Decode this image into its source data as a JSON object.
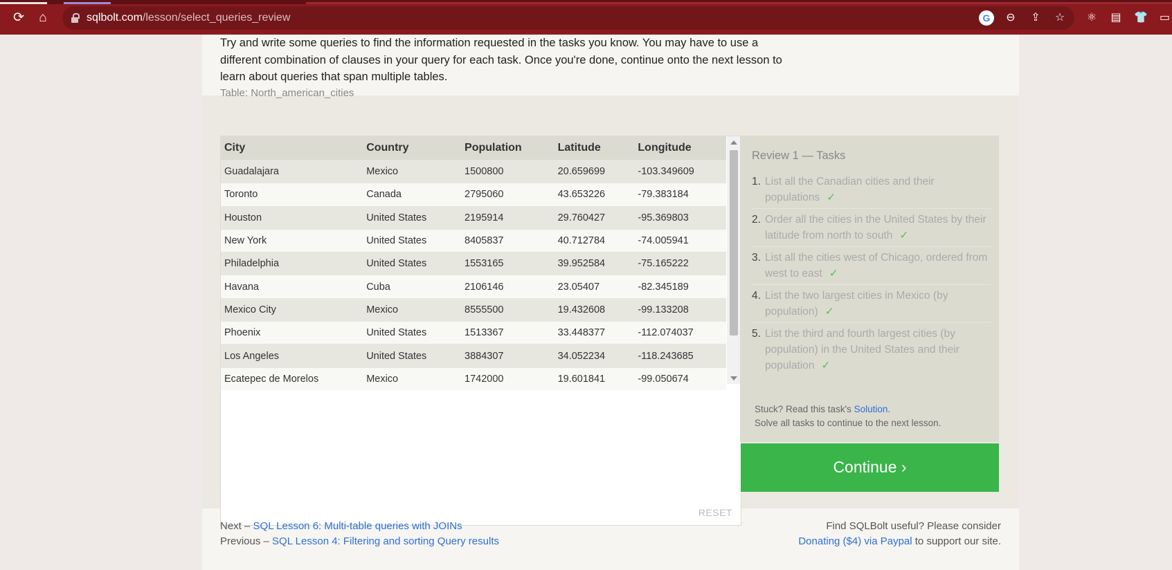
{
  "browser": {
    "url_domain": "sqlbolt.com",
    "url_path": "/lesson/select_queries_review"
  },
  "intro_text": "Try and write some queries to find the information requested in the tasks you know. You may have to use a different combination of clauses in your query for each task. Once you're done, continue onto the next lesson to learn about queries that span multiple tables.",
  "table": {
    "caption": "Table: North_american_cities",
    "columns": [
      "City",
      "Country",
      "Population",
      "Latitude",
      "Longitude"
    ],
    "rows": [
      [
        "Guadalajara",
        "Mexico",
        "1500800",
        "20.659699",
        "-103.349609"
      ],
      [
        "Toronto",
        "Canada",
        "2795060",
        "43.653226",
        "-79.383184"
      ],
      [
        "Houston",
        "United States",
        "2195914",
        "29.760427",
        "-95.369803"
      ],
      [
        "New York",
        "United States",
        "8405837",
        "40.712784",
        "-74.005941"
      ],
      [
        "Philadelphia",
        "United States",
        "1553165",
        "39.952584",
        "-75.165222"
      ],
      [
        "Havana",
        "Cuba",
        "2106146",
        "23.05407",
        "-82.345189"
      ],
      [
        "Mexico City",
        "Mexico",
        "8555500",
        "19.432608",
        "-99.133208"
      ],
      [
        "Phoenix",
        "United States",
        "1513367",
        "33.448377",
        "-112.074037"
      ],
      [
        "Los Angeles",
        "United States",
        "3884307",
        "34.052234",
        "-118.243685"
      ],
      [
        "Ecatepec de Morelos",
        "Mexico",
        "1742000",
        "19.601841",
        "-99.050674"
      ]
    ],
    "reset_label": "RESET"
  },
  "tasks": {
    "title": "Review 1 — Tasks",
    "check": "✓",
    "items": [
      {
        "num": "1.",
        "text": "List all the Canadian cities and their populations"
      },
      {
        "num": "2.",
        "text": "Order all the cities in the United States by their latitude from north to south"
      },
      {
        "num": "3.",
        "text": "List all the cities west of Chicago, ordered from west to east"
      },
      {
        "num": "4.",
        "text": "List the two largest cities in Mexico (by population)"
      },
      {
        "num": "5.",
        "text": "List the third and fourth largest cities (by population) in the United States and their population"
      }
    ],
    "hint_prefix": "Stuck? Read this task's ",
    "hint_link": "Solution",
    "hint_suffix": ".",
    "hint_line2": "Solve all tasks to continue to the next lesson."
  },
  "continue_label": "Continue ›",
  "footer": {
    "next_prefix": "Next – ",
    "next_link": "SQL Lesson 6: Multi-table queries with JOINs",
    "prev_prefix": "Previous – ",
    "prev_link": "SQL Lesson 4: Filtering and sorting Query results",
    "support_line1": "Find SQLBolt useful? Please consider",
    "support_link": "Donating ($4) via Paypal",
    "support_suffix": " to support our site."
  }
}
